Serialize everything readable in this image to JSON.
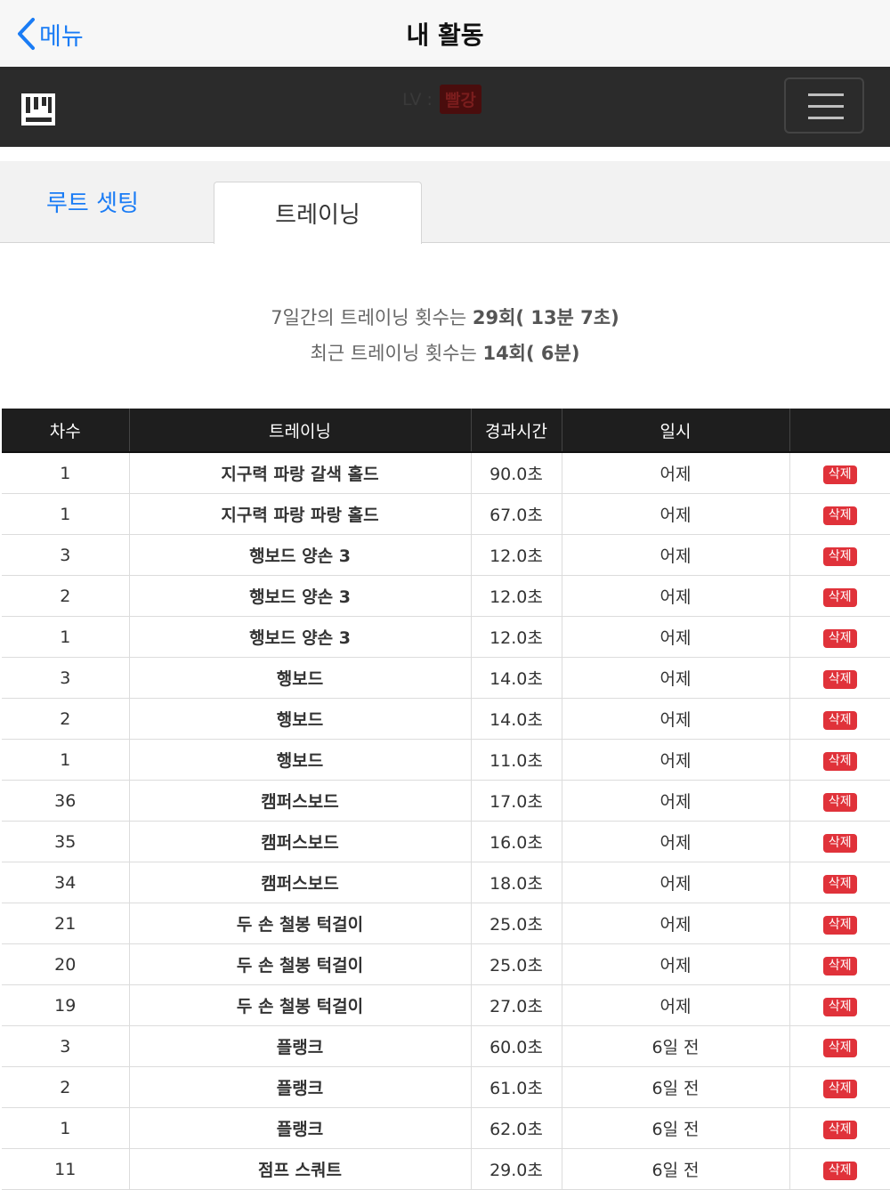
{
  "nav": {
    "back_label": "메뉴",
    "title": "내 활동"
  },
  "header": {
    "level_prefix": "LV :",
    "level_value": "빨강"
  },
  "tabs": [
    {
      "label": "루트 셋팅"
    },
    {
      "label": "트레이닝"
    }
  ],
  "summary": {
    "line1_prefix": "7일간의 트레이닝 횟수는 ",
    "line1_value": "29회( 13분 7초)",
    "line2_prefix": "최근 트레이닝 횟수는 ",
    "line2_value": "14회( 6분)"
  },
  "table": {
    "headers": [
      "차수",
      "트레이닝",
      "경과시간",
      "일시",
      ""
    ],
    "delete_label": "삭제",
    "rows": [
      {
        "round": "1",
        "name": "지구력 파랑 갈색 홀드",
        "elapsed": "90.0초",
        "when": "어제"
      },
      {
        "round": "1",
        "name": "지구력 파랑 파랑 홀드",
        "elapsed": "67.0초",
        "when": "어제"
      },
      {
        "round": "3",
        "name": "행보드 양손 3",
        "elapsed": "12.0초",
        "when": "어제"
      },
      {
        "round": "2",
        "name": "행보드 양손 3",
        "elapsed": "12.0초",
        "when": "어제"
      },
      {
        "round": "1",
        "name": "행보드 양손 3",
        "elapsed": "12.0초",
        "when": "어제"
      },
      {
        "round": "3",
        "name": "행보드",
        "elapsed": "14.0초",
        "when": "어제"
      },
      {
        "round": "2",
        "name": "행보드",
        "elapsed": "14.0초",
        "when": "어제"
      },
      {
        "round": "1",
        "name": "행보드",
        "elapsed": "11.0초",
        "when": "어제"
      },
      {
        "round": "36",
        "name": "캠퍼스보드",
        "elapsed": "17.0초",
        "when": "어제"
      },
      {
        "round": "35",
        "name": "캠퍼스보드",
        "elapsed": "16.0초",
        "when": "어제"
      },
      {
        "round": "34",
        "name": "캠퍼스보드",
        "elapsed": "18.0초",
        "when": "어제"
      },
      {
        "round": "21",
        "name": "두 손 철봉 턱걸이",
        "elapsed": "25.0초",
        "when": "어제"
      },
      {
        "round": "20",
        "name": "두 손 철봉 턱걸이",
        "elapsed": "25.0초",
        "when": "어제"
      },
      {
        "round": "19",
        "name": "두 손 철봉 턱걸이",
        "elapsed": "27.0초",
        "when": "어제"
      },
      {
        "round": "3",
        "name": "플랭크",
        "elapsed": "60.0초",
        "when": "6일 전"
      },
      {
        "round": "2",
        "name": "플랭크",
        "elapsed": "61.0초",
        "when": "6일 전"
      },
      {
        "round": "1",
        "name": "플랭크",
        "elapsed": "62.0초",
        "when": "6일 전"
      },
      {
        "round": "11",
        "name": "점프 스쿼트",
        "elapsed": "29.0초",
        "when": "6일 전"
      }
    ]
  }
}
